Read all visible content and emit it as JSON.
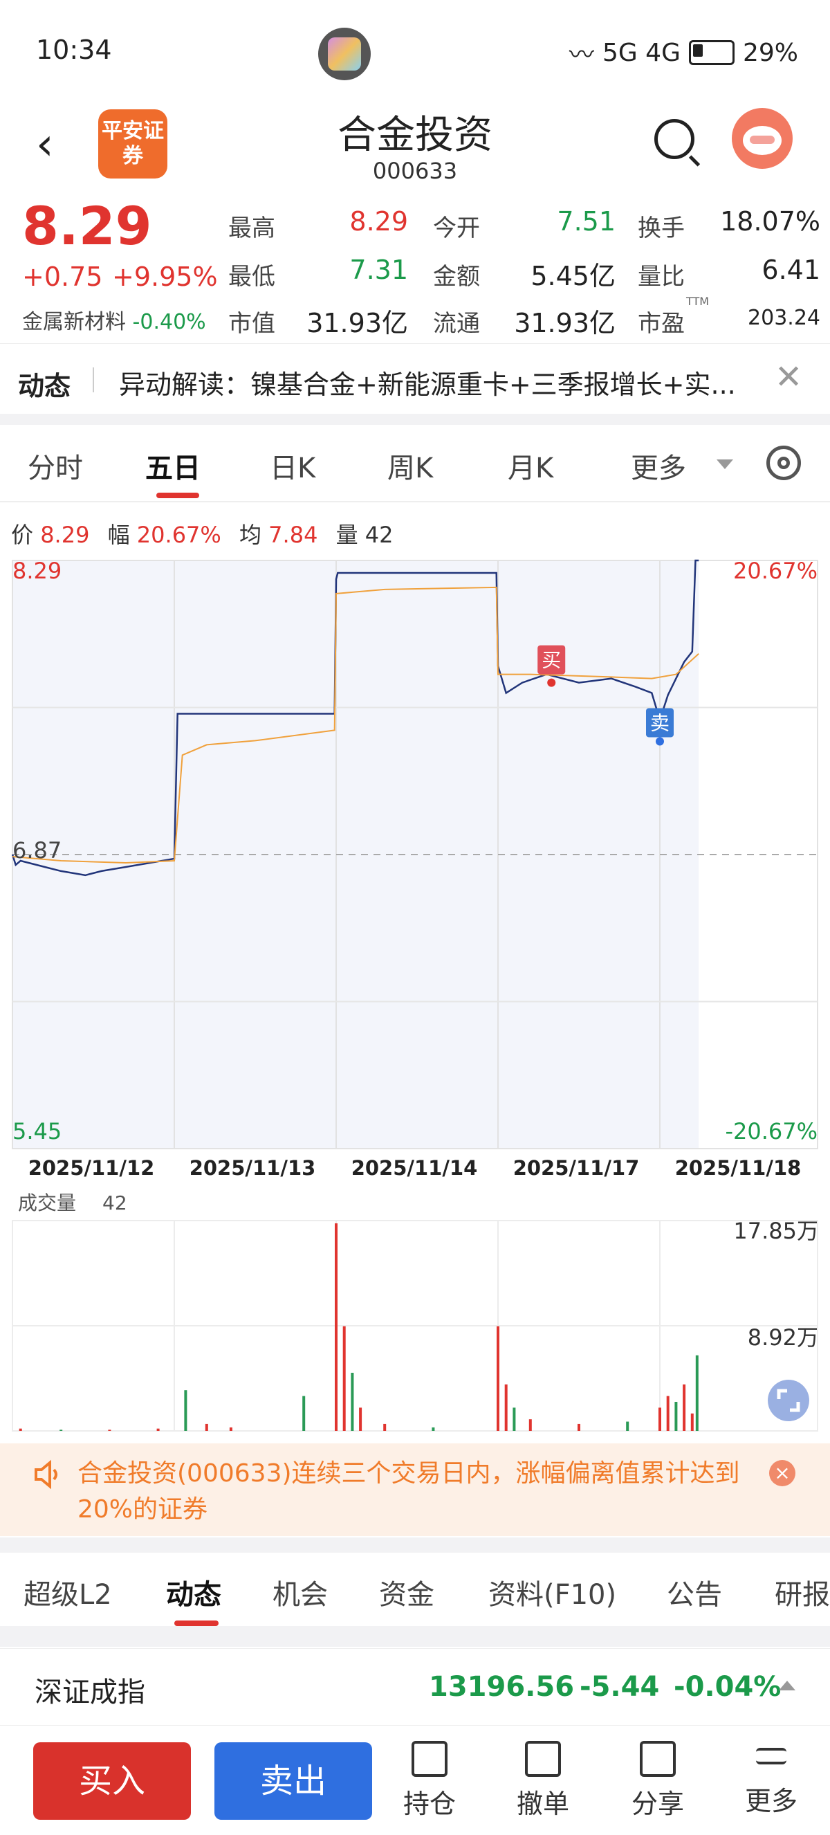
{
  "status": {
    "time": "10:34",
    "network": "5G 4G",
    "battery": "29%"
  },
  "header": {
    "broker_logo": "平安证券",
    "name": "合金投资",
    "code": "000633"
  },
  "quote": {
    "price": "8.29",
    "change": "+0.75",
    "change_pct": "+9.95%",
    "sector": "金属新材料",
    "sector_pct": "-0.40%",
    "fields": [
      {
        "label": "最高",
        "value": "8.29",
        "color": "red"
      },
      {
        "label": "今开",
        "value": "7.51",
        "color": "green"
      },
      {
        "label": "换手",
        "value": "18.07%",
        "color": "black"
      },
      {
        "label": "最低",
        "value": "7.31",
        "color": "green"
      },
      {
        "label": "金额",
        "value": "5.45亿",
        "color": "black"
      },
      {
        "label": "量比",
        "value": "6.41",
        "color": "black"
      },
      {
        "label": "市值",
        "value": "31.93亿",
        "color": "black"
      },
      {
        "label": "流通",
        "value": "31.93亿",
        "color": "black"
      },
      {
        "label": "市盈",
        "value": "203.24",
        "color": "black",
        "sup": "TTM"
      }
    ]
  },
  "dynamic": {
    "title": "动态",
    "text": "异动解读：镍基合金+新能源重卡+三季报增长+实..."
  },
  "tabs": [
    "分时",
    "五日",
    "日K",
    "周K",
    "月K",
    "更多"
  ],
  "chart_info": {
    "price_label": "价",
    "price": "8.29",
    "amp_label": "幅",
    "amp": "20.67%",
    "avg_label": "均",
    "avg": "7.84",
    "vol_label": "量",
    "vol": "42"
  },
  "chart_data": {
    "type": "line",
    "y_axis_left": {
      "top": "8.29",
      "mid": "6.87",
      "bottom": "5.45"
    },
    "y_axis_right": {
      "top": "20.67%",
      "bottom": "-20.67%"
    },
    "ylim": [
      5.45,
      8.29
    ],
    "prev_close": 6.87,
    "dates": [
      "2025/11/12",
      "2025/11/13",
      "2025/11/14",
      "2025/11/17",
      "2025/11/18"
    ],
    "markers": [
      {
        "label": "买",
        "day": 3,
        "price": 7.72
      },
      {
        "label": "卖",
        "day": 4,
        "price": 7.55
      }
    ],
    "series": [
      {
        "values": [
          [
            0.0,
            6.87
          ],
          [
            0.02,
            6.82
          ],
          [
            0.05,
            6.84
          ],
          [
            0.1,
            6.83
          ],
          [
            0.2,
            6.81
          ],
          [
            0.3,
            6.79
          ],
          [
            0.45,
            6.77
          ],
          [
            0.55,
            6.79
          ],
          [
            0.7,
            6.81
          ],
          [
            0.85,
            6.83
          ],
          [
            1.0,
            6.85
          ],
          [
            1.02,
            7.55
          ],
          [
            1.99,
            7.55
          ],
          [
            2.0,
            8.2
          ],
          [
            2.01,
            8.23
          ],
          [
            2.99,
            8.23
          ],
          [
            3.0,
            7.78
          ],
          [
            3.05,
            7.65
          ],
          [
            3.15,
            7.7
          ],
          [
            3.3,
            7.74
          ],
          [
            3.5,
            7.7
          ],
          [
            3.7,
            7.72
          ],
          [
            3.85,
            7.68
          ],
          [
            3.95,
            7.65
          ],
          [
            4.0,
            7.52
          ],
          [
            4.05,
            7.64
          ],
          [
            4.15,
            7.8
          ],
          [
            4.2,
            7.85
          ],
          [
            4.22,
            8.29
          ],
          [
            4.24,
            8.29
          ]
        ]
      },
      {
        "values": [
          [
            0.0,
            6.86
          ],
          [
            0.3,
            6.84
          ],
          [
            0.7,
            6.83
          ],
          [
            1.0,
            6.84
          ],
          [
            1.05,
            7.35
          ],
          [
            1.2,
            7.4
          ],
          [
            1.5,
            7.42
          ],
          [
            1.99,
            7.47
          ],
          [
            2.0,
            8.13
          ],
          [
            2.3,
            8.15
          ],
          [
            2.99,
            8.16
          ],
          [
            3.0,
            7.74
          ],
          [
            3.2,
            7.74
          ],
          [
            3.6,
            7.73
          ],
          [
            3.95,
            7.72
          ],
          [
            4.1,
            7.74
          ],
          [
            4.24,
            7.84
          ]
        ]
      }
    ],
    "volume": {
      "label": "成交量",
      "value": "42",
      "ylabels": [
        "17.85万",
        "8.92万"
      ],
      "ymax": 17.85,
      "bars": [
        [
          0.05,
          0.2
        ],
        [
          0.3,
          0.1
        ],
        [
          0.6,
          0.1
        ],
        [
          0.9,
          0.2
        ],
        [
          1.07,
          3.5
        ],
        [
          1.2,
          0.6
        ],
        [
          1.35,
          0.3
        ],
        [
          1.8,
          3.0
        ],
        [
          2.0,
          17.85
        ],
        [
          2.05,
          9.0
        ],
        [
          2.1,
          5.0
        ],
        [
          2.15,
          2.0
        ],
        [
          2.3,
          0.6
        ],
        [
          2.6,
          0.3
        ],
        [
          3.0,
          9.0
        ],
        [
          3.05,
          4.0
        ],
        [
          3.1,
          2.0
        ],
        [
          3.2,
          1.0
        ],
        [
          3.5,
          0.6
        ],
        [
          3.8,
          0.8
        ],
        [
          4.0,
          2.0
        ],
        [
          4.05,
          3.0
        ],
        [
          4.1,
          2.5
        ],
        [
          4.15,
          4.0
        ],
        [
          4.2,
          1.5
        ],
        [
          4.23,
          6.5
        ]
      ]
    }
  },
  "notice": {
    "text": "合金投资(000633)连续三个交易日内，涨幅偏离值累计达到20%的证券"
  },
  "bottom_tabs": [
    "超级L2",
    "动态",
    "机会",
    "资金",
    "资料(F10)",
    "公告",
    "研报"
  ],
  "index": {
    "name": "深证成指",
    "value": "13196.56",
    "change": "-5.44",
    "change_pct": "-0.04%"
  },
  "actions": {
    "buy": "买入",
    "sell": "卖出",
    "items": [
      "持仓",
      "撤单",
      "分享",
      "更多"
    ]
  }
}
